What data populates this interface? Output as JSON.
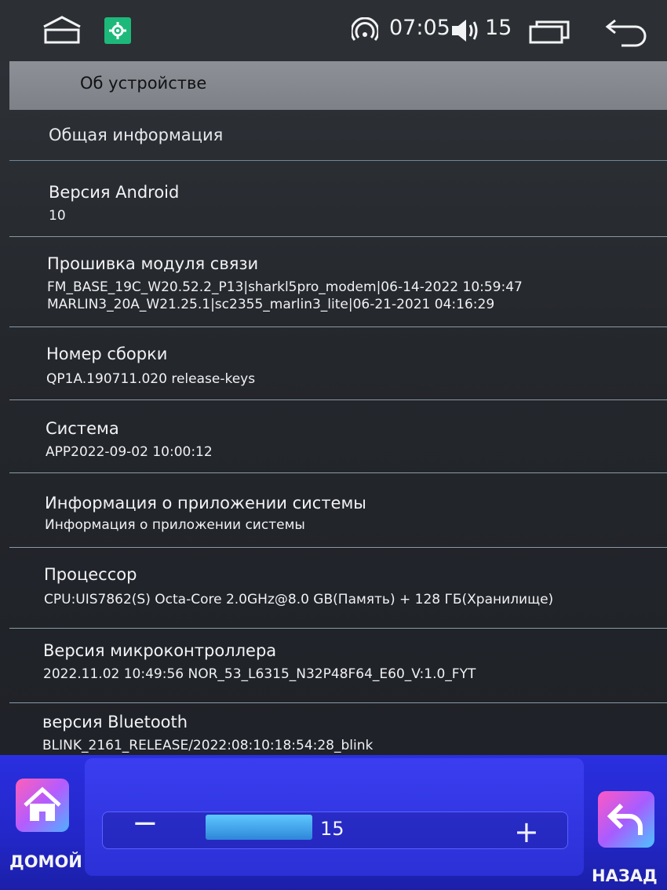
{
  "status_bar": {
    "time": "07:05",
    "volume": "15",
    "icons": [
      "home-outline-icon",
      "settings-gear-icon",
      "hotspot-icon",
      "speaker-icon",
      "recent-apps-icon",
      "back-arrow-icon"
    ],
    "gear_color": "#1db97a"
  },
  "header": {
    "title": "Об устройстве"
  },
  "section": {
    "label": "Общая информация"
  },
  "items": [
    {
      "title": "Версия Android",
      "values": [
        "10"
      ]
    },
    {
      "title": "Прошивка модуля связи",
      "values": [
        "FM_BASE_19C_W20.52.2_P13|sharkl5pro_modem|06-14-2022 10:59:47",
        "MARLIN3_20A_W21.25.1|sc2355_marlin3_lite|06-21-2021 04:16:29"
      ]
    },
    {
      "title": "Номер сборки",
      "values": [
        "QP1A.190711.020 release-keys"
      ]
    },
    {
      "title": "Система",
      "values": [
        "APP2022-09-02 10:00:12"
      ]
    },
    {
      "title": "Информация о приложении системы",
      "values": [
        "Информация о приложении системы"
      ]
    },
    {
      "title": "Процессор",
      "values": [
        "CPU:UIS7862(S) Octa-Core 2.0GHz@8.0 GB(Память) + 128 ГБ(Хранилище)"
      ]
    },
    {
      "title": "Версия микроконтроллера",
      "values": [
        "2022.11.02 10:49:56 NOR_53_L6315_N32P48F64_E60_V:1.0_FYT"
      ]
    },
    {
      "title": "версия Bluetooth",
      "values": [
        "BLINK_2161_RELEASE/2022:08:10:18:54:28_blink"
      ]
    }
  ],
  "bottom_bar": {
    "home_label": "ДОМОЙ",
    "back_label": "НАЗАД",
    "volume_value": "15",
    "volume_minus": "−",
    "volume_plus": "+",
    "accent_color": "#2a2fe0"
  }
}
